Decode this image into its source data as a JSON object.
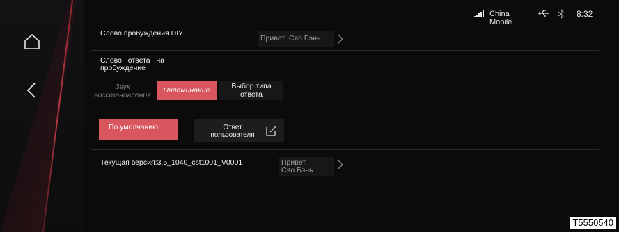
{
  "status_bar": {
    "carrier": "China Mobile",
    "time": "8:32",
    "icons": [
      "signal-icon",
      "usb-icon",
      "bluetooth-icon"
    ]
  },
  "nav": {
    "icons": [
      "home-icon",
      "back-icon"
    ]
  },
  "settings": {
    "wake_word": {
      "label": "Слово пробуждения DIY",
      "value": "Привет  Сяо Бэнь"
    },
    "response_word": {
      "label": "Слово   ответа   на пробуждение"
    },
    "mode_tabs": [
      {
        "label": "Звук восстановления",
        "active": false
      },
      {
        "label": "Напоминание",
        "active": true
      },
      {
        "label": "Выбор типа ответа",
        "active": false
      }
    ],
    "response_type": {
      "default_label": "По умолчанию",
      "user_label": "Ответ пользователя"
    },
    "version": {
      "label": "Текущая версия:3.5_1040_cst1001_V0001",
      "value": "Привет,       Сяо Бэнь"
    }
  },
  "watermark": "T5550540",
  "colors": {
    "accent": "#d9565f",
    "background": "#0b0b0c"
  }
}
